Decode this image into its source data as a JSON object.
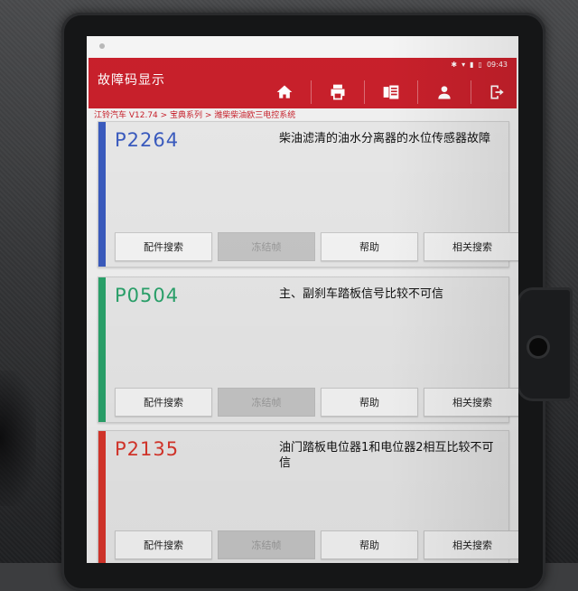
{
  "app": {
    "title": "故障码显示",
    "status": {
      "time": "09:43",
      "icons": [
        "bluetooth-icon",
        "wifi-icon",
        "signal-icon",
        "battery-icon"
      ]
    }
  },
  "toolbar": {
    "items": [
      {
        "icon": "home-icon"
      },
      {
        "icon": "printer-icon"
      },
      {
        "icon": "report-icon"
      },
      {
        "icon": "user-icon"
      },
      {
        "icon": "exit-icon"
      }
    ]
  },
  "breadcrumb": "江铃汽车 V12.74 > 宝典系列 > 潍柴柴油欧三电控系统",
  "buttons": {
    "parts_search": "配件搜索",
    "freeze_frame": "冻结帧",
    "help": "帮助",
    "related_search": "相关搜索"
  },
  "faults": [
    {
      "code": "P2264",
      "description": "柴油滤清的油水分离器的水位传感器故障",
      "color": "#3a5bbf"
    },
    {
      "code": "P0504",
      "description": "主、副刹车踏板信号比较不可信",
      "color": "#2aa36b"
    },
    {
      "code": "P2135",
      "description": "油门踏板电位器1和电位器2相互比较不可信",
      "color": "#d9352b"
    }
  ],
  "colors": {
    "accent": "#c8202b"
  }
}
